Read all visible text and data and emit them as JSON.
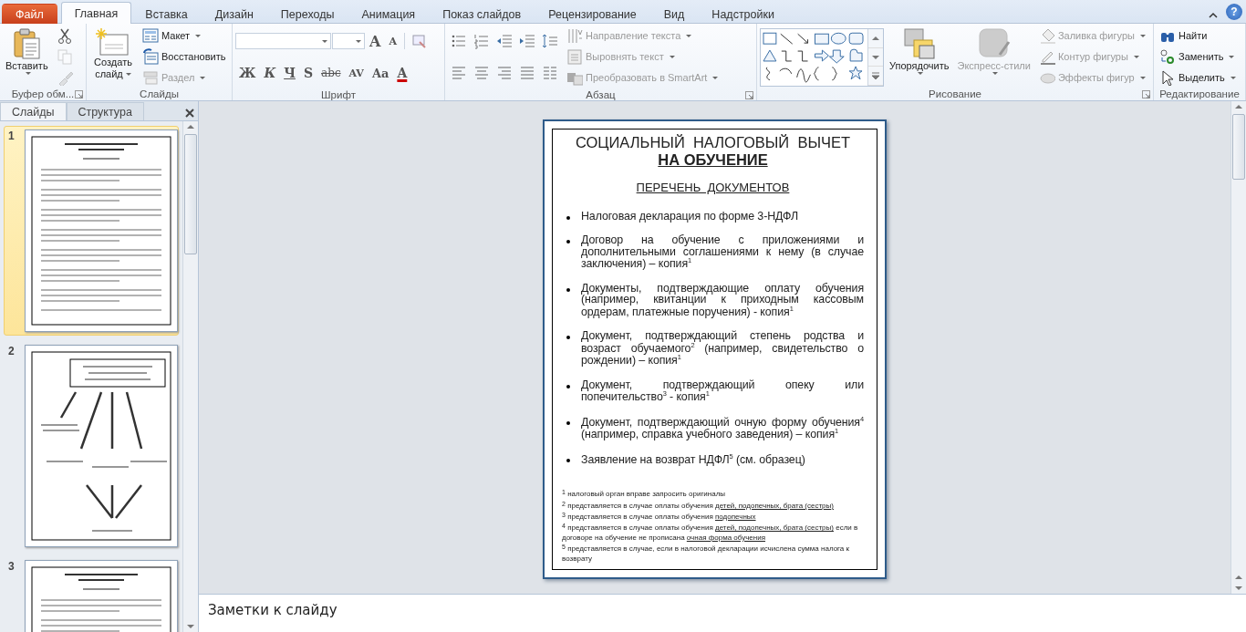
{
  "ribbon_tabs": [
    {
      "label": "Файл",
      "kind": "file",
      "selected": false
    },
    {
      "label": "Главная",
      "kind": "tab",
      "selected": true
    },
    {
      "label": "Вставка",
      "kind": "tab",
      "selected": false
    },
    {
      "label": "Дизайн",
      "kind": "tab",
      "selected": false
    },
    {
      "label": "Переходы",
      "kind": "tab",
      "selected": false
    },
    {
      "label": "Анимация",
      "kind": "tab",
      "selected": false
    },
    {
      "label": "Показ слайдов",
      "kind": "tab",
      "selected": false
    },
    {
      "label": "Рецензирование",
      "kind": "tab",
      "selected": false
    },
    {
      "label": "Вид",
      "kind": "tab",
      "selected": false
    },
    {
      "label": "Надстройки",
      "kind": "tab",
      "selected": false
    }
  ],
  "help_glyph": "?",
  "groups": [
    {
      "kind": "clipboard",
      "label": "Буфер обм...",
      "launcher": true,
      "large": [
        {
          "label": "Вставить",
          "dropdown": true,
          "disabled": false
        }
      ],
      "small": [
        {
          "disabled": false
        },
        {
          "disabled": true
        },
        {
          "disabled": true
        }
      ]
    },
    {
      "kind": "slides",
      "label": "Слайды",
      "large": [
        {
          "label": "Создать слайд",
          "dropdown": true,
          "disabled": false
        }
      ],
      "small": [
        {
          "label": "Макет",
          "dropdown": true,
          "disabled": false
        },
        {
          "label": "Восстановить",
          "dropdown": false,
          "disabled": false
        },
        {
          "label": "Раздел",
          "dropdown": true,
          "disabled": true
        }
      ]
    },
    {
      "kind": "font",
      "label": "Шрифт",
      "row_1": [
        "A",
        "A"
      ],
      "row_2": [
        "Ж",
        "К",
        "Ч",
        "S",
        "abc",
        "AV",
        "Aa",
        "A"
      ]
    },
    {
      "kind": "paragraph",
      "label": "Абзац",
      "launcher": true,
      "small": [
        {
          "label": "Направление текста",
          "dropdown": true,
          "disabled": true
        },
        {
          "label": "Выровнять текст",
          "dropdown": true,
          "disabled": true
        },
        {
          "label": "Преобразовать в SmartArt",
          "dropdown": true,
          "disabled": true
        }
      ]
    },
    {
      "kind": "drawing",
      "label": "Рисование",
      "launcher": true,
      "large": [
        {
          "label": "Упорядочить",
          "dropdown": true,
          "disabled": false
        },
        {
          "label": "Экспресс-стили",
          "dropdown": true,
          "disabled": true
        }
      ],
      "small": [
        {
          "label": "Заливка фигуры",
          "dropdown": true,
          "disabled": true
        },
        {
          "label": "Контур фигуры",
          "dropdown": true,
          "disabled": true
        },
        {
          "label": "Эффекты фигур",
          "dropdown": true,
          "disabled": true
        }
      ]
    },
    {
      "kind": "editing",
      "label": "Редактирование",
      "small": [
        {
          "label": "Найти",
          "dropdown": false,
          "disabled": false
        },
        {
          "label": "Заменить",
          "dropdown": true,
          "disabled": false
        },
        {
          "label": "Выделить",
          "dropdown": true,
          "disabled": false
        }
      ]
    }
  ],
  "side_panel": {
    "tabs": [
      {
        "label": "Слайды",
        "selected": true
      },
      {
        "label": "Структура",
        "selected": false
      }
    ],
    "thumbnails": [
      {
        "number": "1",
        "kind": "list",
        "selected": true
      },
      {
        "number": "2",
        "kind": "diagram",
        "selected": false
      },
      {
        "number": "3",
        "kind": "list",
        "selected": false
      }
    ]
  },
  "slide": {
    "title": "СОЦИАЛЬНЫЙ  НАЛОГОВЫЙ  ВЫЧЕТ",
    "title_emphasis": "НА ОБУЧЕНИЕ",
    "subtitle": "ПЕРЕЧЕНЬ  ДОКУМЕНТОВ",
    "items": [
      "Налоговая декларация по форме 3-НДФЛ",
      "Договор на обучение с приложениями и дополнительными соглашениями к нему (в случае заключения) – копия$^{1}$",
      "Документы, подтверждающие оплату обучения (например, квитанции к приходным кассовым ордерам, платежные поручения) - копия$^{1}$",
      "Документ, подтверждающий степень родства и возраст обучаемого$^{2}$ (например, свидетельство о рождении) – копия$^{1}$",
      "Документ, подтверждающий опеку или попечительство$^{3}$ - копия$^{1}$",
      "Документ, подтверждающий очную форму обучения$^{4}$ (например, справка учебного заведения) – копия$^{1}$",
      "Заявление на возврат НДФЛ$^{5}$ (см. образец)"
    ],
    "footnotes": [
      {
        "mark": "1",
        "parts": [
          {
            "text": "налоговый орган вправе запросить оригиналы",
            "kind": "plain"
          }
        ]
      },
      {
        "mark": "2",
        "parts": [
          {
            "text": "представляется в случае оплаты обучения ",
            "kind": "plain"
          },
          {
            "text": "детей, подопечных, брата (сестры)",
            "kind": "underlined"
          }
        ]
      },
      {
        "mark": "3",
        "parts": [
          {
            "text": "представляется в случае оплаты обучения ",
            "kind": "plain"
          },
          {
            "text": "подопечных",
            "kind": "underlined"
          }
        ]
      },
      {
        "mark": "4",
        "parts": [
          {
            "text": "представляется в случае оплаты обучения ",
            "kind": "plain"
          },
          {
            "text": "детей, подопечных, брата (сестры)",
            "kind": "underlined"
          },
          {
            "text": " если в договоре на обучение не прописана ",
            "kind": "plain"
          },
          {
            "text": "очная форма обучения",
            "kind": "underlined"
          }
        ]
      },
      {
        "mark": "5",
        "parts": [
          {
            "text": "представляется в случае, если в налоговой декларации исчислена сумма налога к возврату",
            "kind": "plain"
          }
        ]
      }
    ]
  },
  "notes": {
    "placeholder": "Заметки к слайду"
  }
}
